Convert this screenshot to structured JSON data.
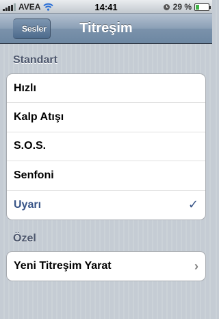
{
  "status_bar": {
    "carrier": "AVEA",
    "time": "14:41",
    "battery_text": "29 %",
    "battery_level": 0.29
  },
  "nav": {
    "back_label": "Sesler",
    "title": "Titreşim"
  },
  "sections": {
    "standard": {
      "header": "Standart",
      "items": [
        {
          "label": "Hızlı",
          "selected": false
        },
        {
          "label": "Kalp Atışı",
          "selected": false
        },
        {
          "label": "S.O.S.",
          "selected": false
        },
        {
          "label": "Senfoni",
          "selected": false
        },
        {
          "label": "Uyarı",
          "selected": true
        }
      ]
    },
    "custom": {
      "header": "Özel",
      "items": [
        {
          "label": "Yeni Titreşim Yarat"
        }
      ]
    }
  },
  "icons": {
    "checkmark": "checkmark-icon",
    "chevron": "chevron-right-icon",
    "wifi": "wifi-icon",
    "alarm": "alarm-clock-icon"
  },
  "colors": {
    "selected_text": "#385487",
    "nav_bar": "#6d87a2",
    "background": "#c5ccd4"
  }
}
